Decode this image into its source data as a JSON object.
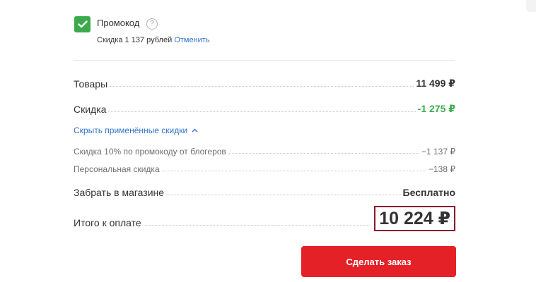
{
  "promo": {
    "checkbox_checked": true,
    "label": "Промокод",
    "help": "?",
    "discount_text": "Скидка 1 137 рублей",
    "cancel_label": "Отменить"
  },
  "summary": {
    "goods_label": "Товары",
    "goods_value": "11 499 ₽",
    "discount_label": "Скидка",
    "discount_value": "-1 275 ₽",
    "toggle_label": "Скрыть применённые скидки",
    "sub_items": [
      {
        "label": "Скидка 10% по промокоду от блогеров",
        "value": "−1 137 ₽"
      },
      {
        "label": "Персональная скидка",
        "value": "−138 ₽"
      }
    ],
    "pickup_label": "Забрать в магазине",
    "pickup_value": "Бесплатно",
    "total_label": "Итого к оплате",
    "total_value": "10 224 ₽"
  },
  "order_button": {
    "label": "Сделать заказ"
  },
  "colors": {
    "accent_green": "#3aaa4a",
    "link_blue": "#2f73c8",
    "button_red": "#e52128",
    "highlight_border": "#8a1b2e"
  }
}
